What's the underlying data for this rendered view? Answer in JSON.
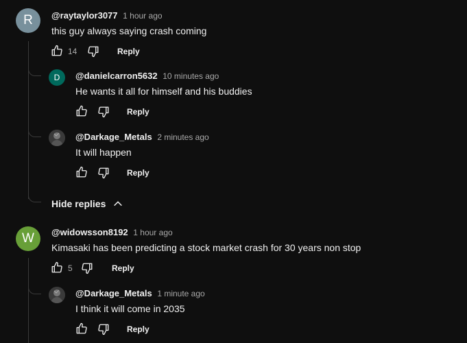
{
  "comments": [
    {
      "avatar_letter": "R",
      "avatar_color": "#78909c",
      "handle": "@raytaylor3077",
      "time": "1 hour ago",
      "text": "this guy always saying crash coming",
      "likes": "14",
      "reply_label": "Reply",
      "replies": [
        {
          "avatar_letter": "D",
          "avatar_color": "#00695c",
          "handle": "@danielcarron5632",
          "time": "10 minutes ago",
          "text": "He wants it all for himself and his buddies",
          "reply_label": "Reply"
        },
        {
          "avatar_letter": "",
          "avatar_color": "#2b2b2b",
          "handle": "@Darkage_Metals",
          "time": "2 minutes ago",
          "text": "It will happen",
          "reply_label": "Reply"
        }
      ],
      "hide_replies_label": "Hide replies"
    },
    {
      "avatar_letter": "W",
      "avatar_color": "#689f38",
      "handle": "@widowsson8192",
      "time": "1 hour ago",
      "text": "Kimasaki has been predicting a stock market crash for 30 years non stop",
      "likes": "5",
      "reply_label": "Reply",
      "replies": [
        {
          "avatar_letter": "",
          "avatar_color": "#2b2b2b",
          "handle": "@Darkage_Metals",
          "time": "1 minute ago",
          "text": "I think it will come in 2035",
          "reply_label": "Reply"
        }
      ]
    }
  ]
}
